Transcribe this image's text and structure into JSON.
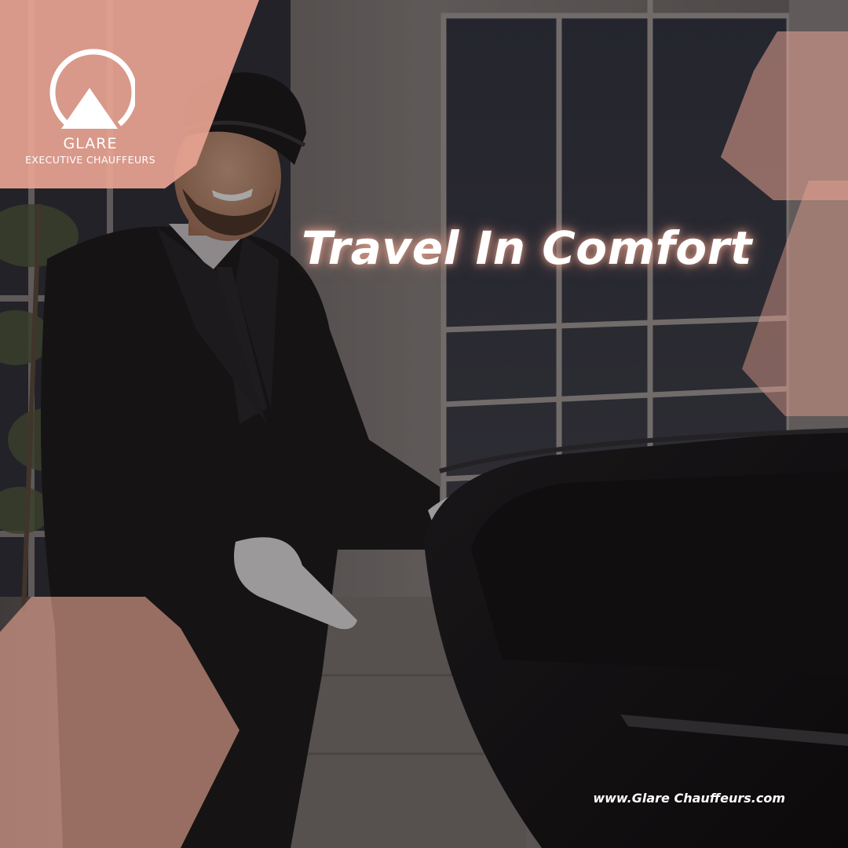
{
  "brand": {
    "name": "GLARE",
    "subtitle": "EXECUTIVE CHAUFFEURS",
    "logo_icon": "mountain-ring-logo-icon"
  },
  "headline": "Travel In Comfort",
  "website": "www.Glare Chauffeurs.com",
  "colors": {
    "accent": "#E8A493",
    "accent_dark": "#B87C6E",
    "text": "#FFFFFF",
    "overlay": "#1E1818"
  },
  "photo": {
    "subject": "chauffeur opening car door"
  }
}
